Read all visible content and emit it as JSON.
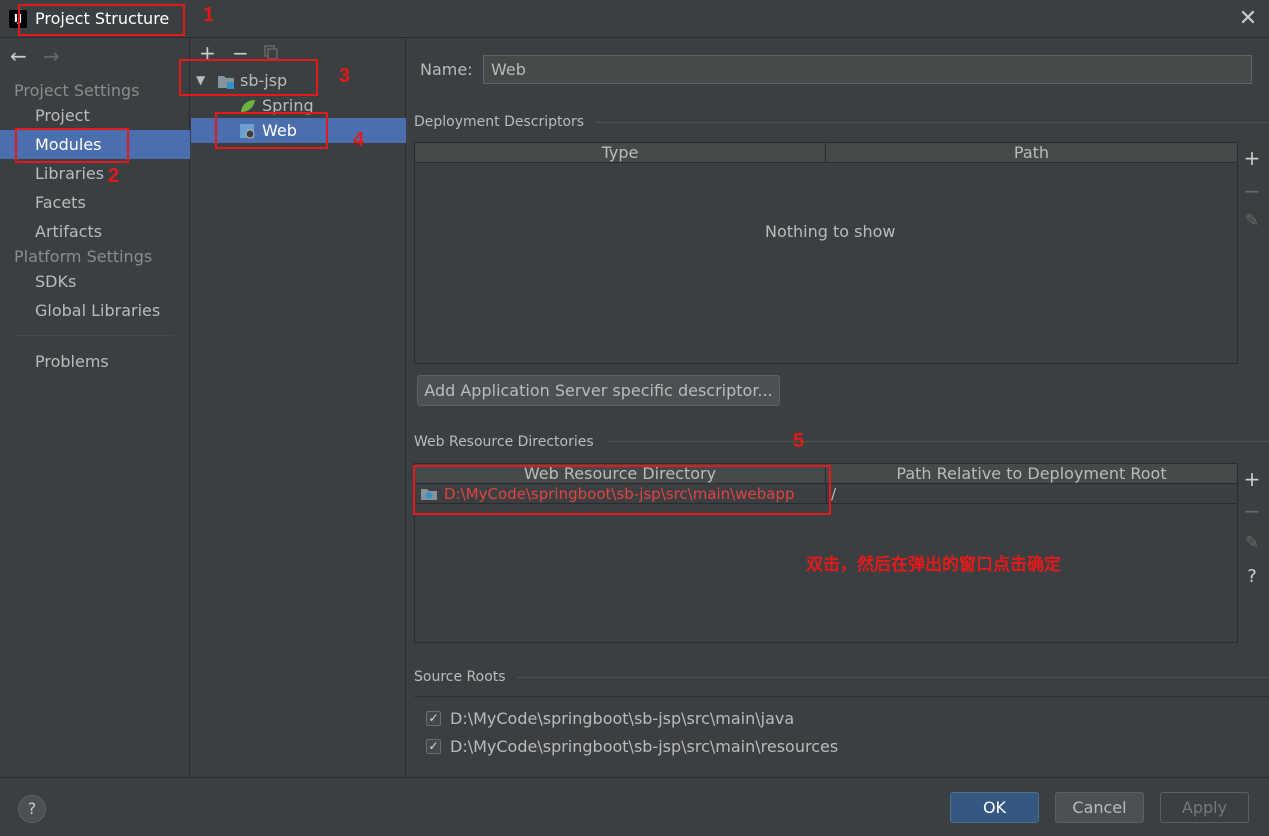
{
  "window": {
    "title": "Project Structure",
    "logo_text": "IJ",
    "close_glyph": "✕"
  },
  "sidebar": {
    "back_arrow": "←",
    "forward_arrow": "→",
    "project_settings_title": "Project Settings",
    "project_settings_items": [
      "Project",
      "Modules",
      "Libraries",
      "Facets",
      "Artifacts"
    ],
    "platform_settings_title": "Platform Settings",
    "platform_settings_items": [
      "SDKs",
      "Global Libraries"
    ],
    "problems": "Problems",
    "selected": "Modules"
  },
  "tree": {
    "toolbar": {
      "add": "+",
      "remove": "−"
    },
    "root": {
      "label": "sb-jsp",
      "expand_glyph": "▼"
    },
    "children": [
      {
        "label": "Spring"
      },
      {
        "label": "Web",
        "selected": true
      }
    ]
  },
  "content": {
    "name_label": "Name:",
    "name_value": "Web",
    "deployment_descriptors": {
      "title": "Deployment Descriptors",
      "columns": [
        "Type",
        "Path"
      ],
      "empty_text": "Nothing to show",
      "add_button": "Add Application Server specific descriptor..."
    },
    "web_resource_dirs": {
      "title": "Web Resource Directories",
      "columns": [
        "Web Resource Directory",
        "Path Relative to Deployment Root"
      ],
      "rows": [
        {
          "directory": "D:\\MyCode\\springboot\\sb-jsp\\src\\main\\webapp",
          "relative_path": "/"
        }
      ]
    },
    "source_roots": {
      "title": "Source Roots",
      "items": [
        {
          "path": "D:\\MyCode\\springboot\\sb-jsp\\src\\main\\java",
          "checked": true
        },
        {
          "path": "D:\\MyCode\\springboot\\sb-jsp\\src\\main\\resources",
          "checked": true
        }
      ]
    },
    "tools": {
      "add": "+",
      "remove": "−",
      "edit": "✎",
      "help": "?"
    }
  },
  "buttons": {
    "help": "?",
    "ok": "OK",
    "cancel": "Cancel",
    "apply": "Apply"
  },
  "annotations": {
    "numbers": [
      "1",
      "2",
      "3",
      "4",
      "5"
    ],
    "note": "双击，然后在弹出的窗口点击确定"
  },
  "colors": {
    "accent_selection": "#4b6eaf",
    "annotation_red": "#e21a1a",
    "background": "#3c3f41"
  }
}
